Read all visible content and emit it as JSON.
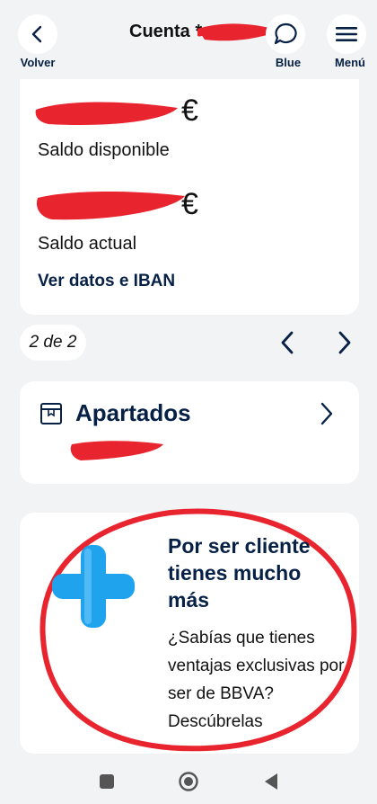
{
  "header": {
    "title": "Cuenta *",
    "back_label": "Volver",
    "blue_label": "Blue",
    "menu_label": "Menú",
    "icons": {
      "back": "chevron-left-icon",
      "blue": "chat-bubble-icon",
      "menu": "hamburger-menu-icon"
    }
  },
  "account": {
    "currency": "€",
    "available_label": "Saldo disponible",
    "current_label": "Saldo actual",
    "iban_link": "Ver datos e IBAN"
  },
  "pager": {
    "text": "2 de 2",
    "icons": {
      "prev": "chevron-left-icon",
      "next": "chevron-right-icon"
    }
  },
  "apartados": {
    "title": "Apartados",
    "icons": {
      "box": "box-icon",
      "open": "chevron-right-icon"
    }
  },
  "promo": {
    "title": "Por ser cliente tienes mucho más",
    "text": "¿Sabías que tienes ventajas exclusivas por ser de BBVA? Descúbrelas",
    "icon": "plus-icon"
  },
  "colors": {
    "brand_navy": "#072146",
    "background": "#f2f3f5",
    "card": "#ffffff",
    "redaction": "#e8252f",
    "plus_blue": "#1ea3ec"
  }
}
